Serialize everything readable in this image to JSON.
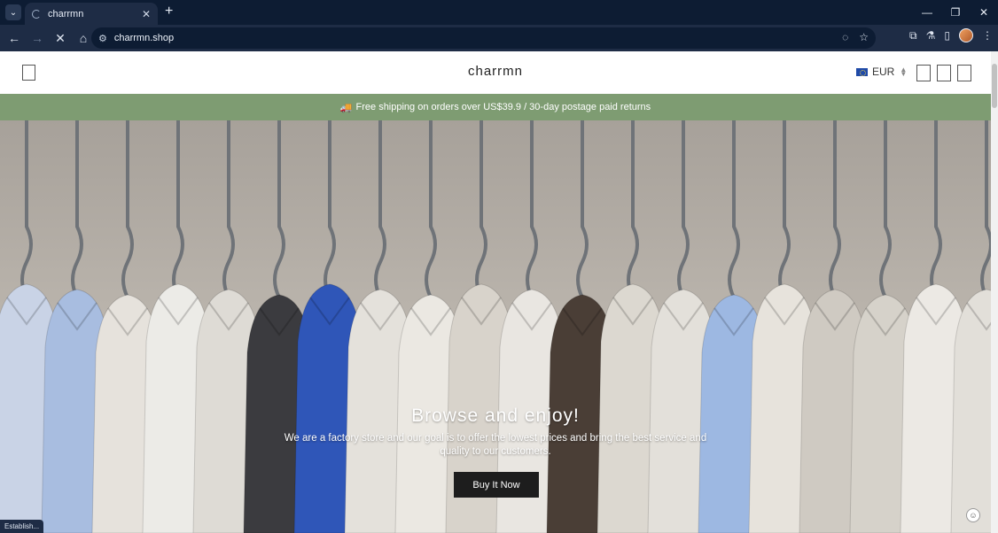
{
  "browser": {
    "tab_title": "charrmn",
    "url": "charrmn.shop",
    "status_text": "Establish..."
  },
  "site": {
    "brand": "charrmn",
    "currency": "EUR",
    "announcement": "Free shipping on orders over US$39.9 / 30-day postage paid returns",
    "announcement_emoji": "🚚"
  },
  "hero": {
    "title": "Browse and enjoy!",
    "subtitle": "We are a factory store and our goal is to offer the lowest prices and bring the best service and quality to our customers.",
    "button_label": "Buy It Now"
  },
  "colors": {
    "announce_bg": "#7e9c72",
    "button_bg": "#1d1d1d",
    "chrome_dark": "#0d1c33",
    "chrome_toolbar": "#1e2c45"
  },
  "icons": {
    "tab_menu": "chevron-down-icon",
    "new_tab": "plus-icon",
    "back": "arrow-left-icon",
    "forward": "arrow-right-icon",
    "reload": "stop-icon",
    "home": "home-icon",
    "site_info": "tune-icon",
    "eye_off": "eye-off-icon",
    "bookmark": "star-icon",
    "extensions": "puzzle-icon",
    "labs": "flask-icon",
    "sidepanel": "sidepanel-icon",
    "menu": "more-vertical-icon"
  }
}
